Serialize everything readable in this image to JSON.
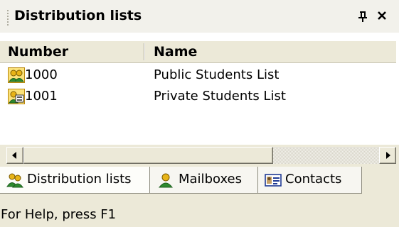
{
  "panel": {
    "title": "Distribution lists",
    "pin_glyph": "ѱ",
    "close_glyph": "✕",
    "pin_icon": "pin-icon",
    "close_icon": "close-icon"
  },
  "list": {
    "columns": [
      {
        "label": "Number"
      },
      {
        "label": "Name"
      }
    ],
    "rows": [
      {
        "number": "1000",
        "name": "Public Students List",
        "icon": "public-list-icon"
      },
      {
        "number": "1001",
        "name": "Private Students List",
        "icon": "private-list-icon"
      }
    ]
  },
  "tabs": [
    {
      "label": "Distribution lists",
      "icon": "distribution-lists-icon",
      "active": true
    },
    {
      "label": "Mailboxes",
      "icon": "mailbox-user-icon",
      "active": false
    },
    {
      "label": "Contacts",
      "icon": "contact-card-icon",
      "active": false
    }
  ],
  "status": {
    "text": "For Help, press F1"
  },
  "colors": {
    "window_bg": "#ece9d8",
    "list_bg": "#ffffff",
    "icon_gold": "#e8b418",
    "icon_green": "#2e8a2e"
  }
}
